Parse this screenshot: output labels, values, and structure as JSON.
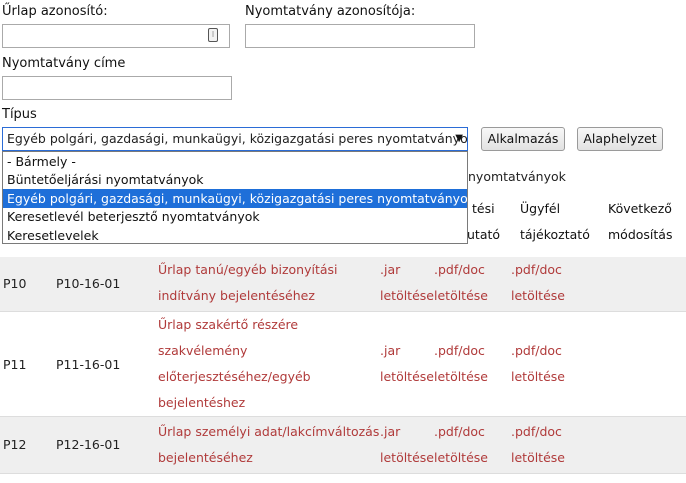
{
  "form": {
    "urlap_azonosito_label": "Űrlap azonosító:",
    "urlap_azonosito_value": "",
    "nyomtatvany_azonositoja_label": "Nyomtatvány azonosítója:",
    "nyomtatvany_azonositoja_value": "",
    "nyomtatvany_cime_label": "Nyomtatvány címe",
    "nyomtatvany_cime_value": "",
    "tipus_label": "Típus",
    "tipus_selected": "Egyéb polgári, gazdasági, munkaügyi, közigazgatási peres nyomtatványok",
    "apply_button": "Alkalmazás",
    "reset_button": "Alaphelyzet"
  },
  "dropdown": {
    "options": [
      "- Bármely -",
      "Büntetőeljárási nyomtatványok",
      "Egyéb polgári, gazdasági, munkaügyi, közigazgatási peres nyomtatványok",
      "Keresetlevél beterjesztő nyomtatványok",
      "Keresetlevelek"
    ],
    "selected_index": 2
  },
  "behind_dropdown_fragment": "nyomtatványok",
  "table": {
    "headers": {
      "col5_line1": "tési",
      "col5_line2": "utató",
      "col6_line1": "Ügyfél",
      "col6_line2": "tájékoztató",
      "col7_line1": "Következő",
      "col7_line2": "módosítás"
    },
    "rows": [
      {
        "code": "P10",
        "id": "P10-16-01",
        "title_lines": [
          "Űrlap tanú/egyéb bizonyítási",
          "indítvány bejelentéséhez"
        ],
        "jar": [
          ".jar",
          "letöltése"
        ],
        "pdf": [
          ".pdf/doc",
          "letöltése"
        ],
        "info": [
          ".pdf/doc",
          "letöltése"
        ]
      },
      {
        "code": "P11",
        "id": "P11-16-01",
        "title_lines": [
          "Űrlap szakértő részére",
          "szakvélemény",
          "előterjesztéséhez/egyéb",
          "bejelentéshez"
        ],
        "jar": [
          ".jar",
          "letöltése"
        ],
        "pdf": [
          ".pdf/doc",
          "letöltése"
        ],
        "info": [
          ".pdf/doc",
          "letöltése"
        ]
      },
      {
        "code": "P12",
        "id": "P12-16-01",
        "title_lines": [
          "Űrlap személyi adat/lakcímváltozás",
          "bejelentéséhez"
        ],
        "jar": [
          ".jar",
          "letöltése"
        ],
        "pdf": [
          ".pdf/doc",
          "letöltése"
        ],
        "info": [
          ".pdf/doc",
          "letöltése"
        ]
      }
    ]
  }
}
